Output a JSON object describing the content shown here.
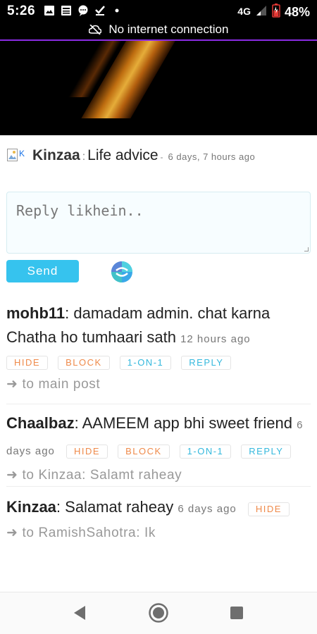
{
  "status_bar": {
    "time": "5:26",
    "network_label": "4G",
    "battery": "48%",
    "connection_message": "No internet connection"
  },
  "post": {
    "avatar_alt": "K",
    "author": "Kinzaa",
    "separator": ":",
    "title": "Life advice",
    "time_sep": "-",
    "time": "6 days, 7 hours ago"
  },
  "reply": {
    "placeholder": "Reply likhein..",
    "send_label": "Send"
  },
  "comments": [
    {
      "author": "mohb11",
      "text": ": damadam admin. chat karna Chatha ho tumhaari sath",
      "time": "12 hours ago",
      "actions": [
        "HIDE",
        "BLOCK",
        "1-ON-1",
        "REPLY"
      ],
      "link": "to main post"
    },
    {
      "author": "Chaalbaz",
      "text": ": AAMEEM app bhi sweet friend",
      "time": "6 days ago",
      "actions": [
        "HIDE",
        "BLOCK",
        "1-ON-1",
        "REPLY"
      ],
      "link": "to Kinzaa: Salamt raheay"
    },
    {
      "author": "Kinzaa",
      "text": ": Salamat raheay",
      "time": "6 days ago",
      "actions": [
        "HIDE"
      ],
      "link": "to RamishSahotra: Ik"
    }
  ],
  "colors": {
    "accent": "#36c3ee",
    "action_orange": "#ef8a4a",
    "action_blue": "#34b8dd"
  }
}
